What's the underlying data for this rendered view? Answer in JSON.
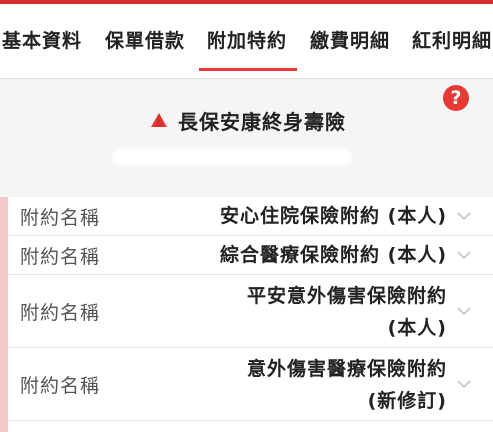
{
  "tabs": [
    {
      "label": "基本資料"
    },
    {
      "label": "保單借款"
    },
    {
      "label": "附加特約",
      "active": true
    },
    {
      "label": "繳費明細"
    },
    {
      "label": "紅利明細"
    }
  ],
  "header": {
    "help_icon": "?",
    "product_name": "長保安康終身壽險",
    "logo_icon": "triangle-logo-icon"
  },
  "riders": [
    {
      "label": "附約名稱",
      "value_lines": [
        "安心住院保險附約 (本人)"
      ]
    },
    {
      "label": "附約名稱",
      "value_lines": [
        "綜合醫療保險附約 (本人)"
      ]
    },
    {
      "label": "附約名稱",
      "value_lines": [
        "平安意外傷害保險附約",
        "(本人)"
      ]
    },
    {
      "label": "附約名稱",
      "value_lines": [
        "意外傷害醫療保險附約",
        "(新修訂)"
      ]
    }
  ],
  "colors": {
    "accent": "#e53935",
    "left_bar": "#f6c9c9"
  }
}
